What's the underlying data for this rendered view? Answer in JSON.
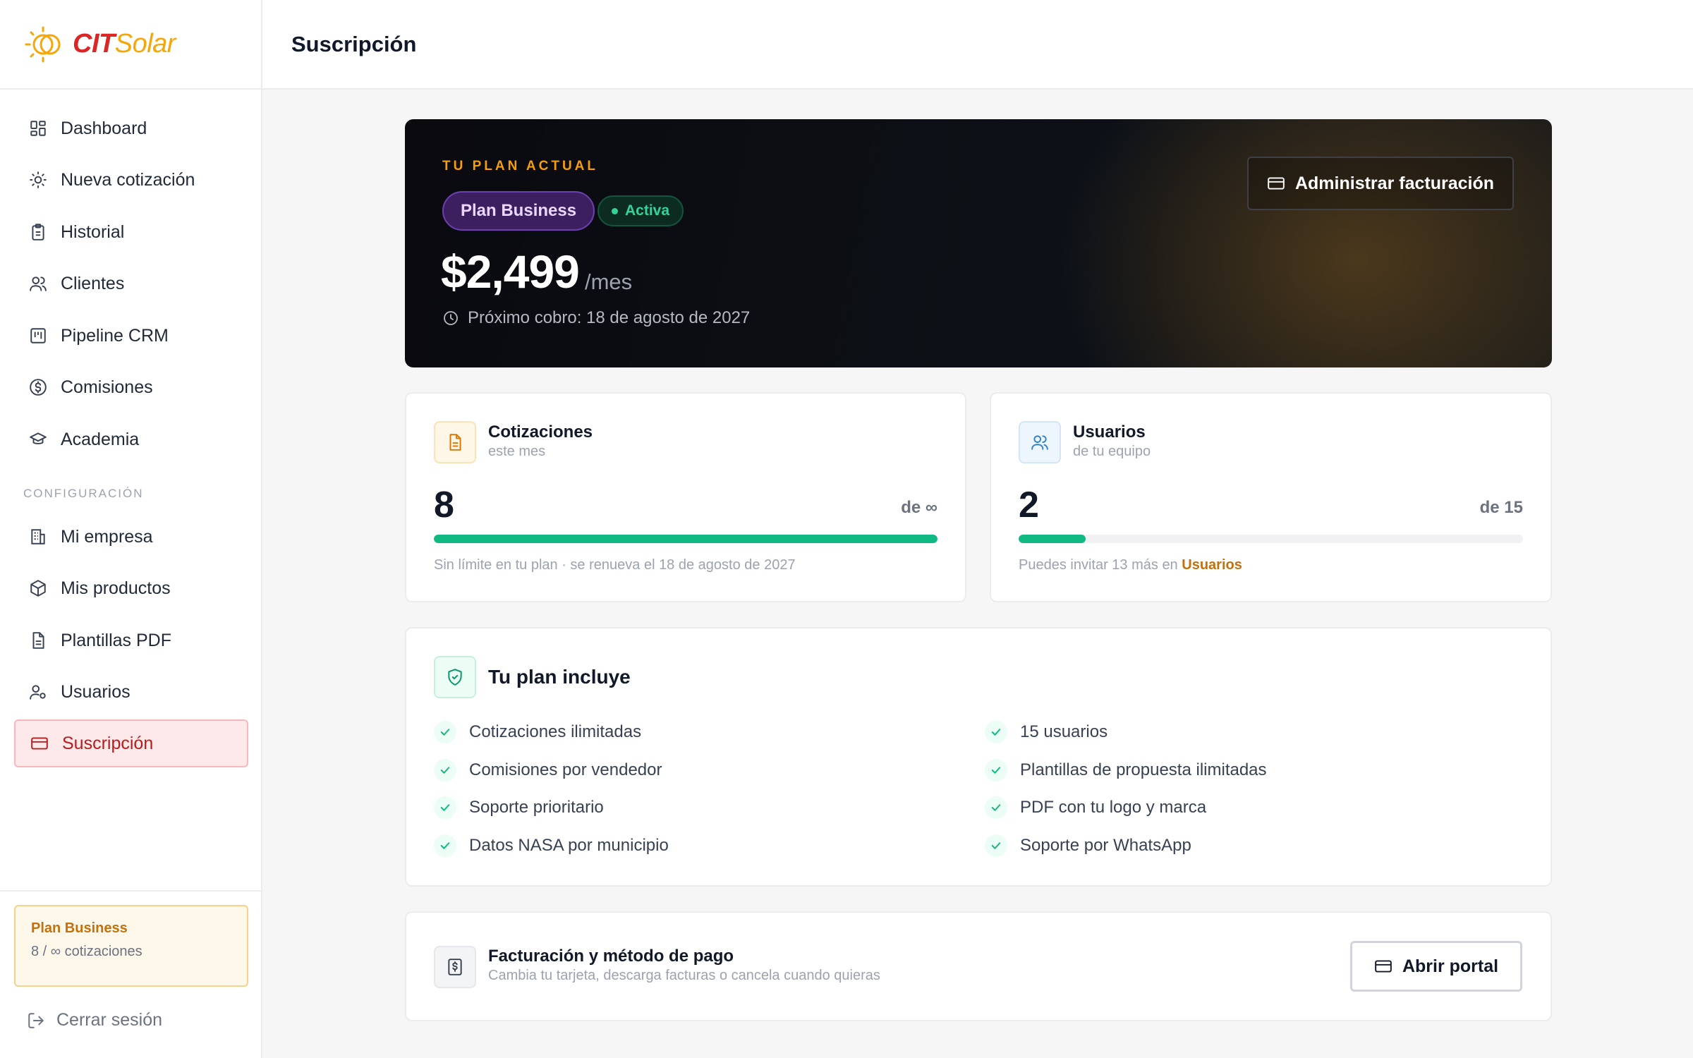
{
  "brand": {
    "name_part1": "CIT",
    "name_part2": "Solar",
    "logo_icon": "sun-icon"
  },
  "header": {
    "title": "Suscripción"
  },
  "sidebar": {
    "items": [
      {
        "label": "Dashboard",
        "icon": "dashboard-icon"
      },
      {
        "label": "Nueva cotización",
        "icon": "sun-icon"
      },
      {
        "label": "Historial",
        "icon": "clipboard-icon"
      },
      {
        "label": "Clientes",
        "icon": "users-icon"
      },
      {
        "label": "Pipeline CRM",
        "icon": "kanban-icon"
      },
      {
        "label": "Comisiones",
        "icon": "dollar-circle-icon"
      },
      {
        "label": "Academia",
        "icon": "graduation-cap-icon"
      }
    ],
    "section_label": "CONFIGURACIÓN",
    "config_items": [
      {
        "label": "Mi empresa",
        "icon": "building-icon"
      },
      {
        "label": "Mis productos",
        "icon": "box-icon"
      },
      {
        "label": "Plantillas PDF",
        "icon": "file-icon"
      },
      {
        "label": "Usuarios",
        "icon": "user-cog-icon"
      },
      {
        "label": "Suscripción",
        "icon": "credit-card-icon",
        "active": true
      }
    ],
    "plan_box": {
      "title": "Plan Business",
      "usage": "8 / ∞ cotizaciones"
    },
    "logout": "Cerrar sesión"
  },
  "hero": {
    "eyebrow": "TU PLAN ACTUAL",
    "plan_badge": "Plan Business",
    "status_badge": "Activa",
    "price": "$2,499",
    "period": "/mes",
    "next_charge": "Próximo cobro: 18 de agosto de 2027",
    "billing_button": "Administrar facturación"
  },
  "usage": {
    "quotes": {
      "title": "Cotizaciones",
      "subtitle": "este mes",
      "value": "8",
      "limit": "de ∞",
      "fill": 1.0,
      "note": "Sin límite en tu plan · se renueva el 18 de agosto de 2027"
    },
    "users": {
      "title": "Usuarios",
      "subtitle": "de tu equipo",
      "value": "2",
      "limit": "de 15",
      "fill": 0.133,
      "note_prefix": "Puedes invitar 13 más en ",
      "note_link": "Usuarios"
    }
  },
  "includes": {
    "title": "Tu plan incluye",
    "left": [
      "Cotizaciones ilimitadas",
      "Comisiones por vendedor",
      "Soporte prioritario",
      "Datos NASA por municipio"
    ],
    "right": [
      "15 usuarios",
      "Plantillas de propuesta ilimitadas",
      "PDF con tu logo y marca",
      "Soporte por WhatsApp"
    ]
  },
  "billing": {
    "title": "Facturación y método de pago",
    "subtitle": "Cambia tu tarjeta, descarga facturas o cancela cuando quieras",
    "button": "Abrir portal"
  },
  "colors": {
    "accent_red": "#b91c1c",
    "accent_orange": "#f59e0b",
    "success": "#10b981"
  }
}
